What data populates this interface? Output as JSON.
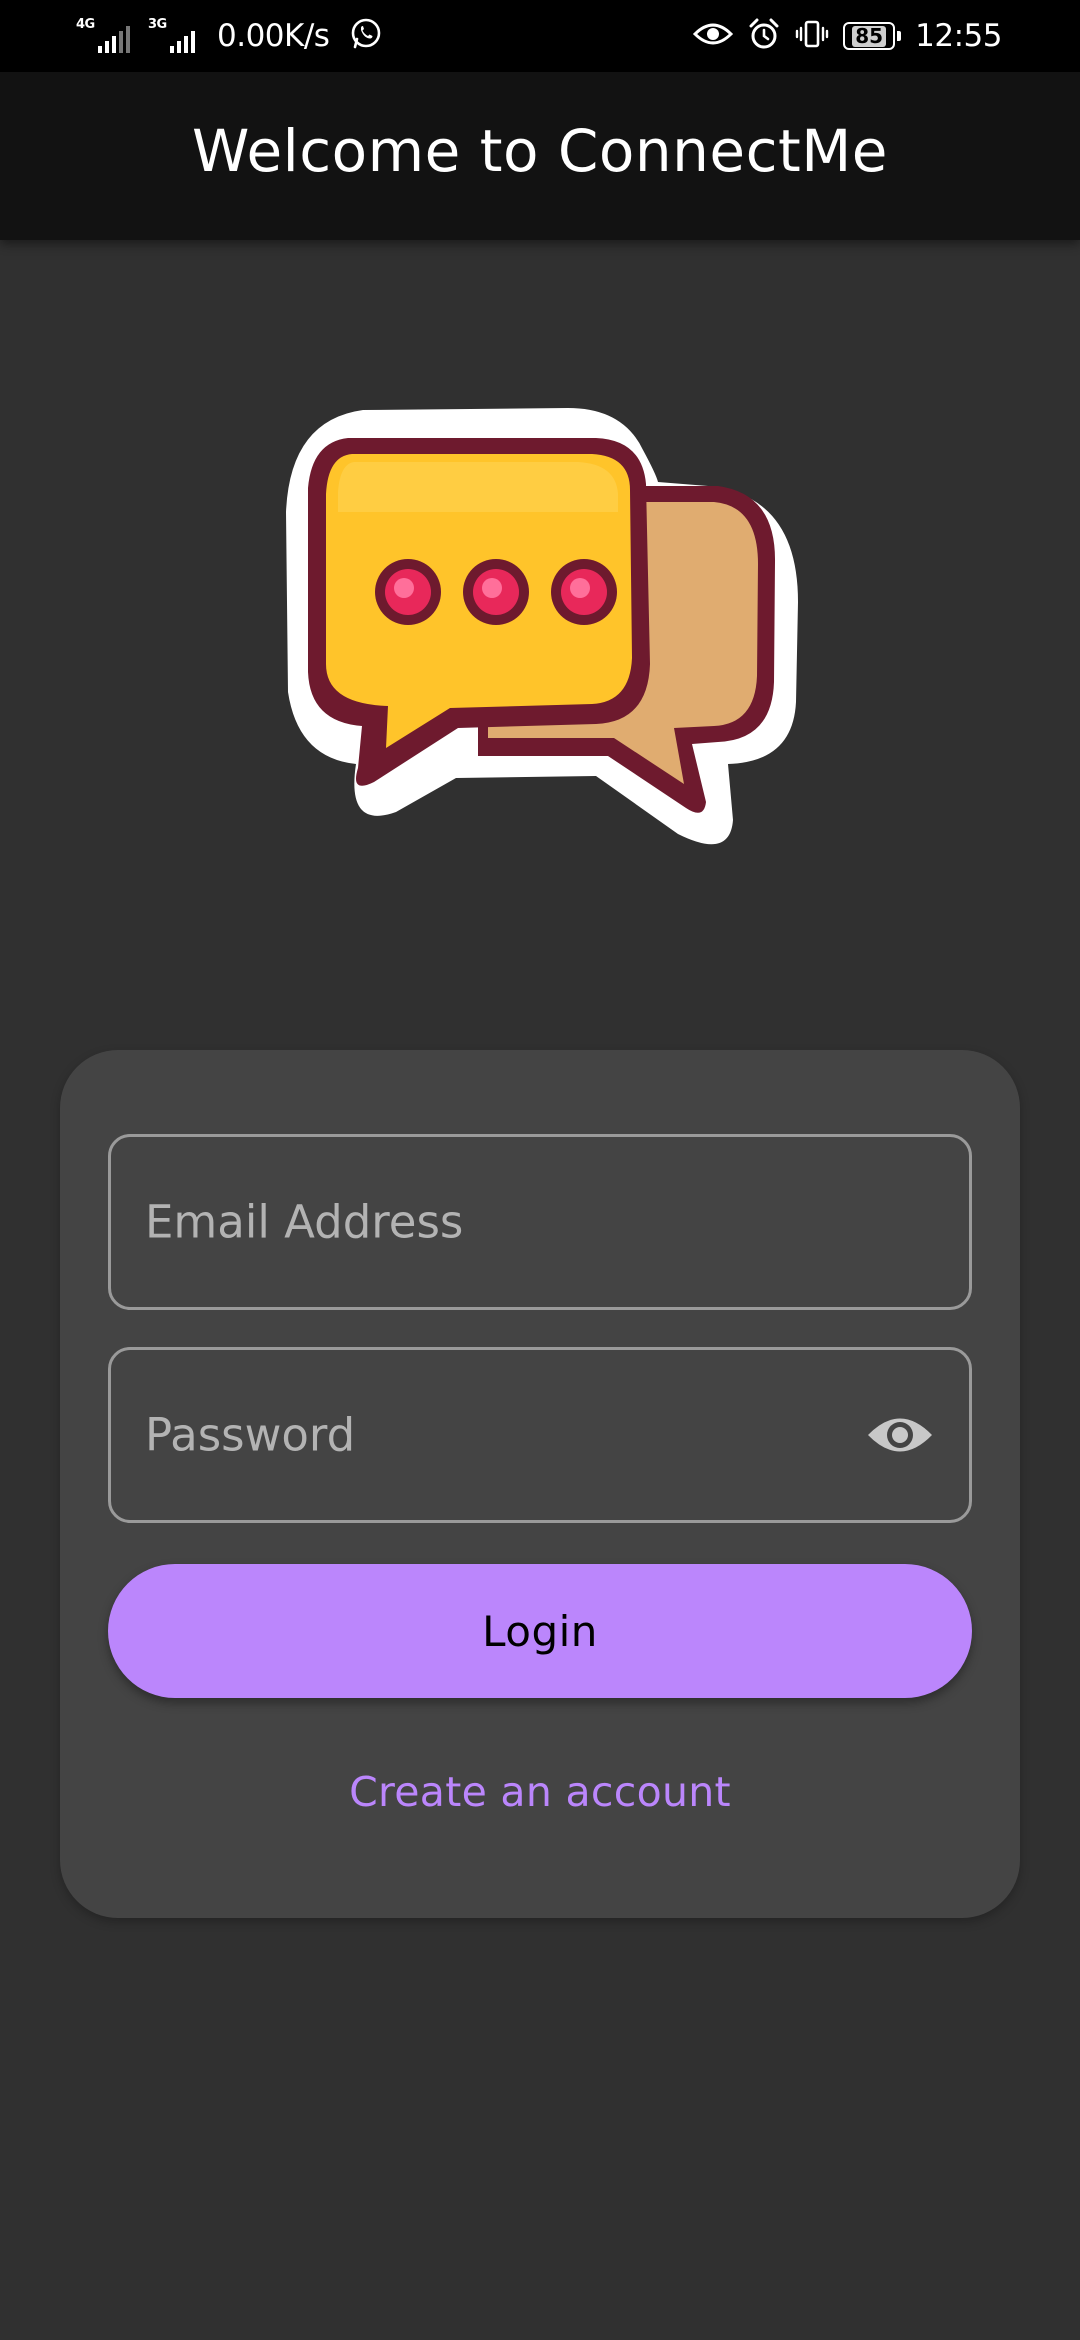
{
  "status_bar": {
    "network_1": "4G",
    "network_2": "3G",
    "speed": "0.00K/s",
    "battery": "85",
    "time": "12:55",
    "icons": [
      "whatsapp-icon",
      "eye-comfort-icon",
      "alarm-icon",
      "vibrate-icon",
      "battery-icon"
    ]
  },
  "app_bar": {
    "title": "Welcome to ConnectMe"
  },
  "logo": {
    "icon": "chat-bubbles-logo",
    "colors": {
      "outline": "#6e1a2e",
      "front_bubble": "#ffc42a",
      "back_bubble": "#e0ac70",
      "dots": "#e8285a"
    }
  },
  "login_form": {
    "email_placeholder": "Email Address",
    "password_placeholder": "Password",
    "password_toggle_icon": "eye-icon",
    "login_label": "Login",
    "create_account_label": "Create an account"
  },
  "theme": {
    "background": "#303030",
    "app_bar": "#121212",
    "card": "#444444",
    "accent": "#bb86fc"
  }
}
